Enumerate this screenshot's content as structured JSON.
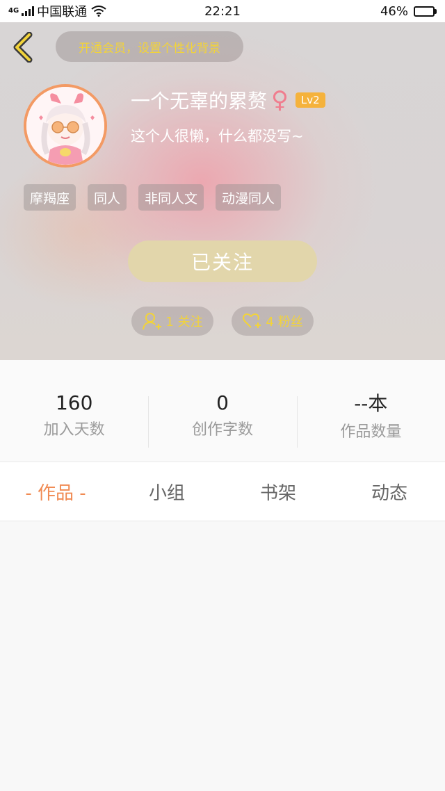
{
  "status_bar": {
    "network": "4G",
    "carrier": "中国联通",
    "time": "22:21",
    "battery_percent": "46%",
    "battery_level": 0.46
  },
  "header": {
    "vip_text": "开通会员，设置个性化背景",
    "username": "一个无辜的累赘",
    "gender_symbol": "♀",
    "level": "Lv2",
    "bio": "这个人很懒，什么都没写~",
    "tags": [
      "摩羯座",
      "同人",
      "非同人文",
      "动漫同人"
    ],
    "follow_button": "已关注",
    "following_text": "1 关注",
    "fans_text": "4 粉丝"
  },
  "stats": [
    {
      "value": "160",
      "label": "加入天数"
    },
    {
      "value": "0",
      "label": "创作字数"
    },
    {
      "value": "--本",
      "label": "作品数量"
    }
  ],
  "tabs": [
    "- 作品 -",
    "小组",
    "书架",
    "动态"
  ],
  "colors": {
    "accent_orange": "#f08a52",
    "vip_yellow": "#f2d33a",
    "follow_button": "#e2d6ab",
    "level_badge": "#f5b23c"
  }
}
